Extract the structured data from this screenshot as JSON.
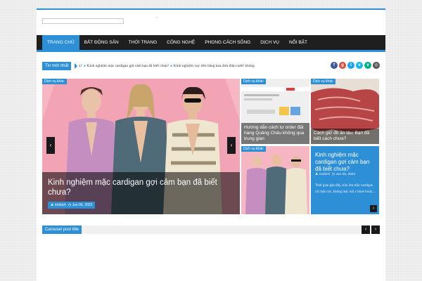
{
  "header": {
    "ad_mark": "*"
  },
  "nav": {
    "items": [
      {
        "label": "Trang chủ",
        "active": true
      },
      {
        "label": "Bất động sản"
      },
      {
        "label": "Thời trang"
      },
      {
        "label": "Công nghệ"
      },
      {
        "label": "Phong cách sống"
      },
      {
        "label": "Dịch vụ"
      },
      {
        "label": "Nổi bật"
      }
    ]
  },
  "ticker": {
    "label": "Tin mới nhất",
    "items": [
      "z?",
      "Kinh nghiệm mặc cardigan gợi cảm bạn đã biết chưa?",
      "Kinh nghiệm vay tiền bằng hóa đơn điện nước không"
    ]
  },
  "social": [
    {
      "icon": "facebook-icon",
      "glyph": "f",
      "color": "#3b5998"
    },
    {
      "icon": "google-plus-icon",
      "glyph": "g",
      "color": "#dd4b39"
    },
    {
      "icon": "twitter-icon",
      "glyph": "t",
      "color": "#1da1f2"
    },
    {
      "icon": "vimeo-icon",
      "glyph": "v",
      "color": "#1ab7ea"
    },
    {
      "icon": "vine-icon",
      "glyph": "v",
      "color": "#00b488"
    },
    {
      "icon": "instagram-icon",
      "glyph": "◎",
      "color": "#555555"
    }
  ],
  "main_slider": {
    "tag": "Dịch vụ khác",
    "title": "Kinh nghiệm mặc cardigan gợi cảm bạn đã biết chưa?",
    "author": "mobich",
    "date": "Jun 06, 2023",
    "prev": "‹",
    "next": "›"
  },
  "tiles": {
    "t1": {
      "tag": "Dịch vụ khác",
      "title": "Hướng dẫn cách tự order đặt hàng Quảng Châu không qua trung gian"
    },
    "t2": {
      "tag": "Dịch vụ khác",
      "title": "Cách giữ đồ ăn lâu: Bạn đã biết cách chưa?"
    },
    "t3": {
      "tag": "Dịch vụ khác"
    }
  },
  "featured": {
    "title": "Kinh nghiệm mặc cardigan gợi cảm bạn đã biết chưa?",
    "author": "mobich",
    "date": "Jun 06, 2023",
    "excerpt": "Thời gian gần đây, trào lưu mặc cardigan cài một cúc, không mặc nội y khoe body....",
    "arrow": "›"
  },
  "carousel": {
    "title": "Carousel post title",
    "prev": "‹",
    "next": "›"
  },
  "colors": {
    "accent": "#2d8fd5",
    "nav_bg": "#1f1f1f"
  }
}
